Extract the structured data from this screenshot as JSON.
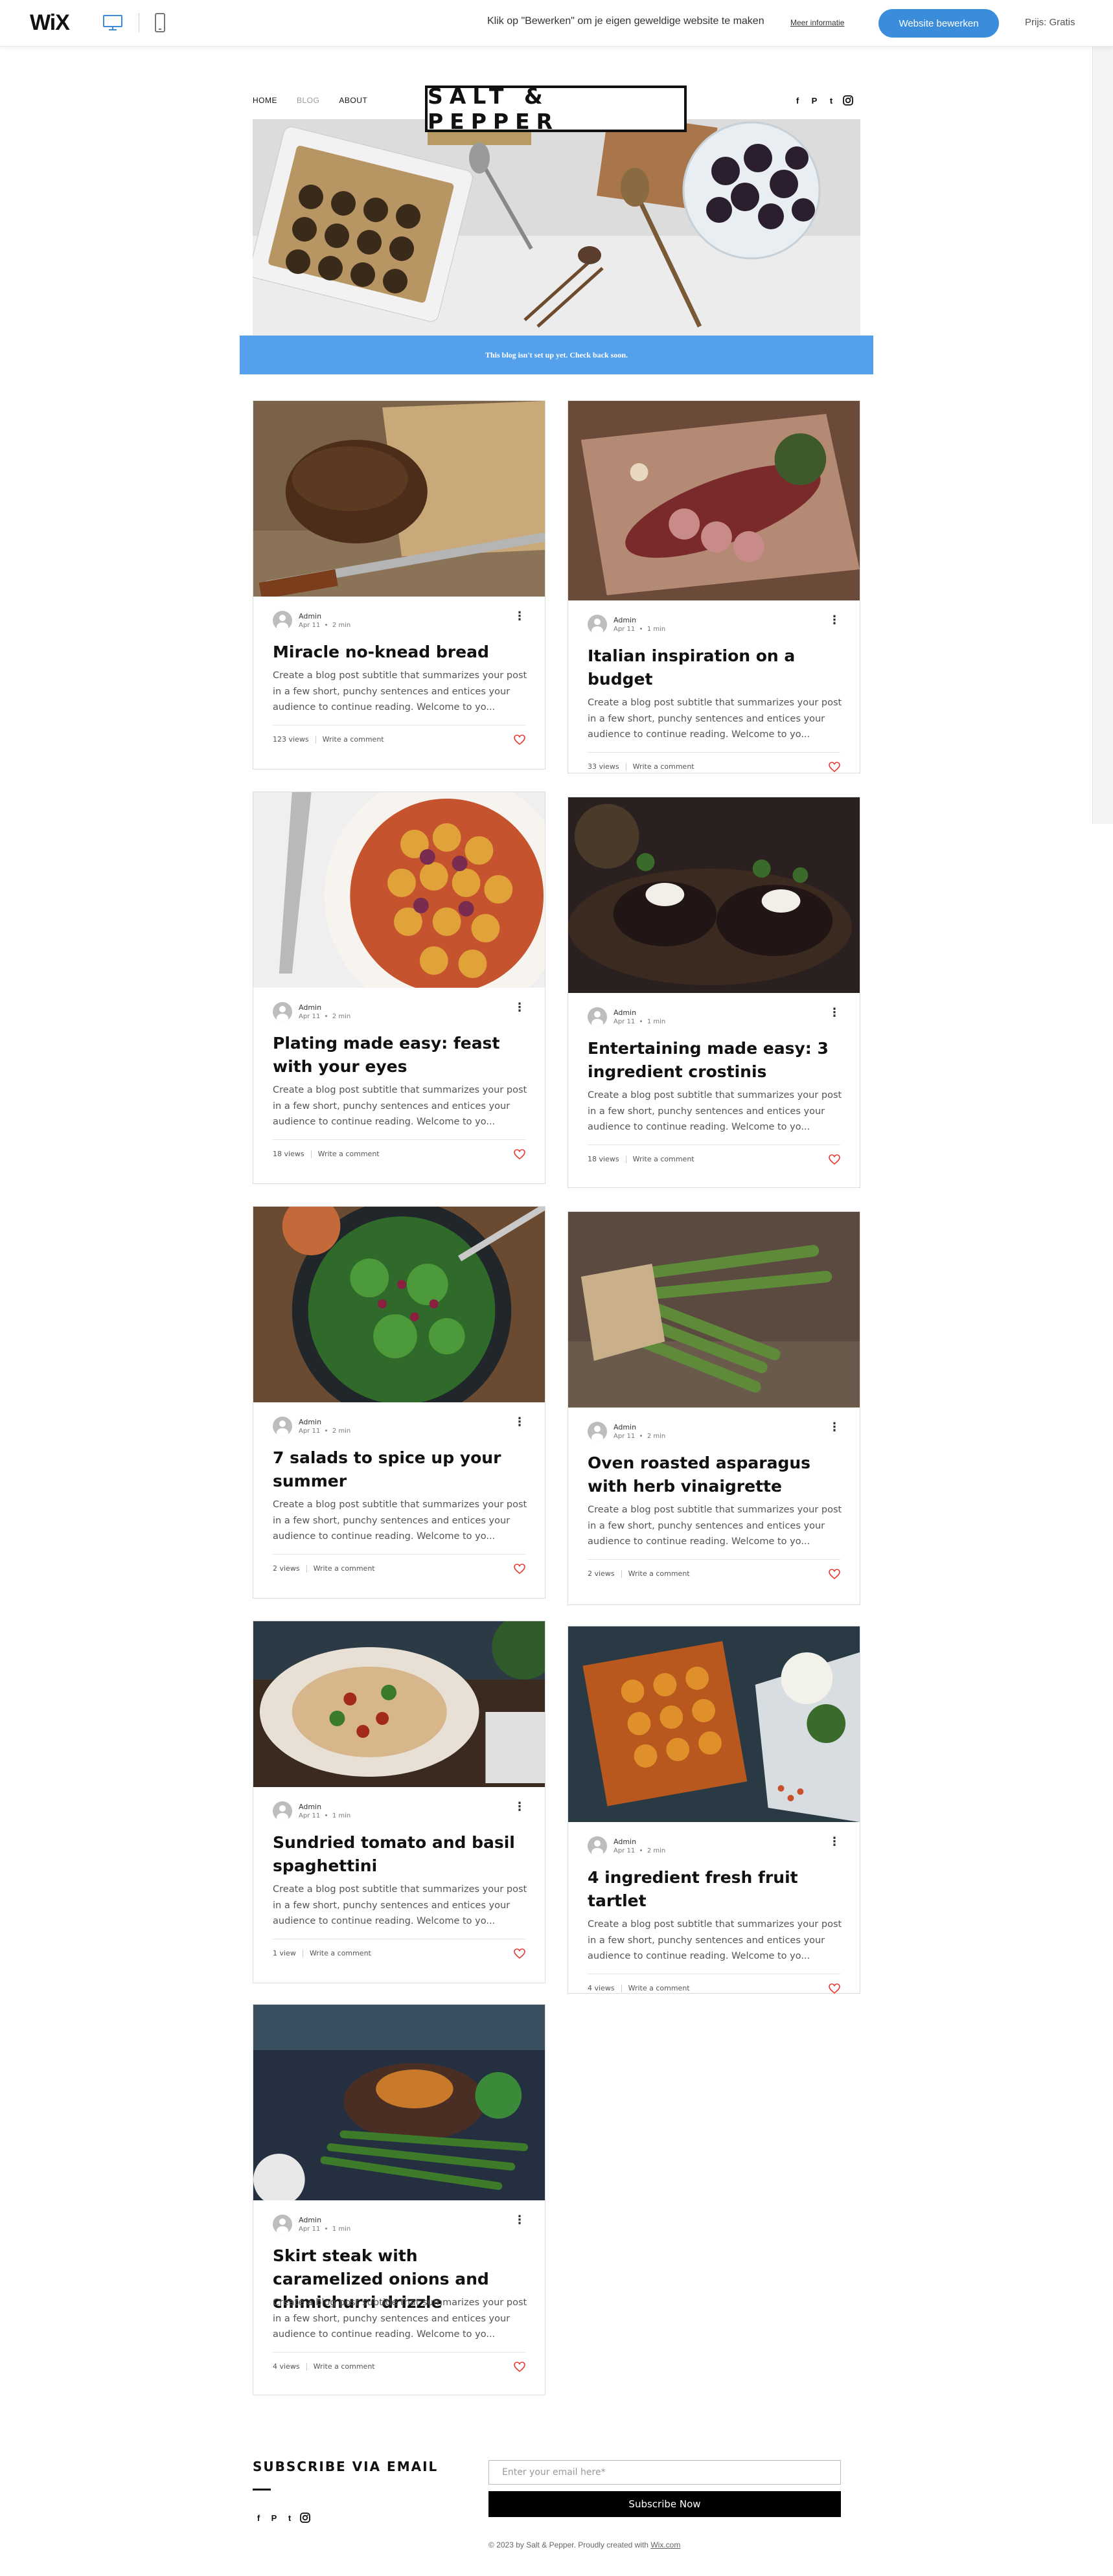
{
  "topbar": {
    "logo": "WiX",
    "message": "Klik op \"Bewerken\" om je eigen geweldige website te maken",
    "more_info": "Meer informatie",
    "edit_button": "Website bewerken",
    "price": "Prijs: Gratis"
  },
  "site": {
    "nav": [
      "HOME",
      "BLOG",
      "ABOUT"
    ],
    "logo": "SALT & PEPPER",
    "social": [
      "f",
      "P",
      "t",
      "ig"
    ],
    "banner": "This blog isn't set up yet. Check back soon."
  },
  "posts": [
    {
      "author": "Admin",
      "date": "Apr 11",
      "read": "2 min",
      "title": "Miracle no-knead bread",
      "excerpt": "Create a blog post subtitle that summarizes your post in a few short, punchy sentences and entices your audience to continue reading. Welcome to yo...",
      "views": "123 views",
      "comment": "Write a comment"
    },
    {
      "author": "Admin",
      "date": "Apr 11",
      "read": "1 min",
      "title": "Italian inspiration on a budget",
      "excerpt": "Create a blog post subtitle that summarizes your post in a few short, punchy sentences and entices your audience to continue reading. Welcome to yo...",
      "views": "33 views",
      "comment": "Write a comment"
    },
    {
      "author": "Admin",
      "date": "Apr 11",
      "read": "2 min",
      "title": "Plating made easy: feast with your eyes",
      "excerpt": "Create a blog post subtitle that summarizes your post in a few short, punchy sentences and entices your audience to continue reading. Welcome to yo...",
      "views": "18 views",
      "comment": "Write a comment"
    },
    {
      "author": "Admin",
      "date": "Apr 11",
      "read": "1 min",
      "title": "Entertaining made easy: 3 ingredient crostinis",
      "excerpt": "Create a blog post subtitle that summarizes your post in a few short, punchy sentences and entices your audience to continue reading. Welcome to yo...",
      "views": "18 views",
      "comment": "Write a comment"
    },
    {
      "author": "Admin",
      "date": "Apr 11",
      "read": "2 min",
      "title": "7 salads to spice up your summer",
      "excerpt": "Create a blog post subtitle that summarizes your post in a few short, punchy sentences and entices your audience to continue reading. Welcome to yo...",
      "views": "2 views",
      "comment": "Write a comment"
    },
    {
      "author": "Admin",
      "date": "Apr 11",
      "read": "2 min",
      "title": "Oven roasted asparagus with herb vinaigrette",
      "excerpt": "Create a blog post subtitle that summarizes your post in a few short, punchy sentences and entices your audience to continue reading. Welcome to yo...",
      "views": "2 views",
      "comment": "Write a comment"
    },
    {
      "author": "Admin",
      "date": "Apr 11",
      "read": "1 min",
      "title": "Sundried tomato and basil spaghettini",
      "excerpt": "Create a blog post subtitle that summarizes your post in a few short, punchy sentences and entices your audience to continue reading. Welcome to yo...",
      "views": "1 view",
      "comment": "Write a comment"
    },
    {
      "author": "Admin",
      "date": "Apr 11",
      "read": "2 min",
      "title": "4 ingredient fresh fruit tartlet",
      "excerpt": "Create a blog post subtitle that summarizes your post in a few short, punchy sentences and entices your audience to continue reading. Welcome to yo...",
      "views": "4 views",
      "comment": "Write a comment"
    },
    {
      "author": "Admin",
      "date": "Apr 11",
      "read": "1 min",
      "title": "Skirt steak with caramelized onions and chimichurri drizzle",
      "excerpt": "Create a blog post subtitle that summarizes your post in a few short, punchy sentences and entices your audience to continue reading. Welcome to yo...",
      "views": "4 views",
      "comment": "Write a comment"
    }
  ],
  "footer": {
    "subscribe_title": "SUBSCRIBE VIA EMAIL",
    "email_placeholder": "Enter your email here*",
    "subscribe_button": "Subscribe Now",
    "copyright": "© 2023 by Salt & Pepper. Proudly created with",
    "wix_link": "Wix.com"
  },
  "colors": {
    "accent": "#3b8ddb",
    "banner": "#55a0eb",
    "heart": "#e53935"
  }
}
